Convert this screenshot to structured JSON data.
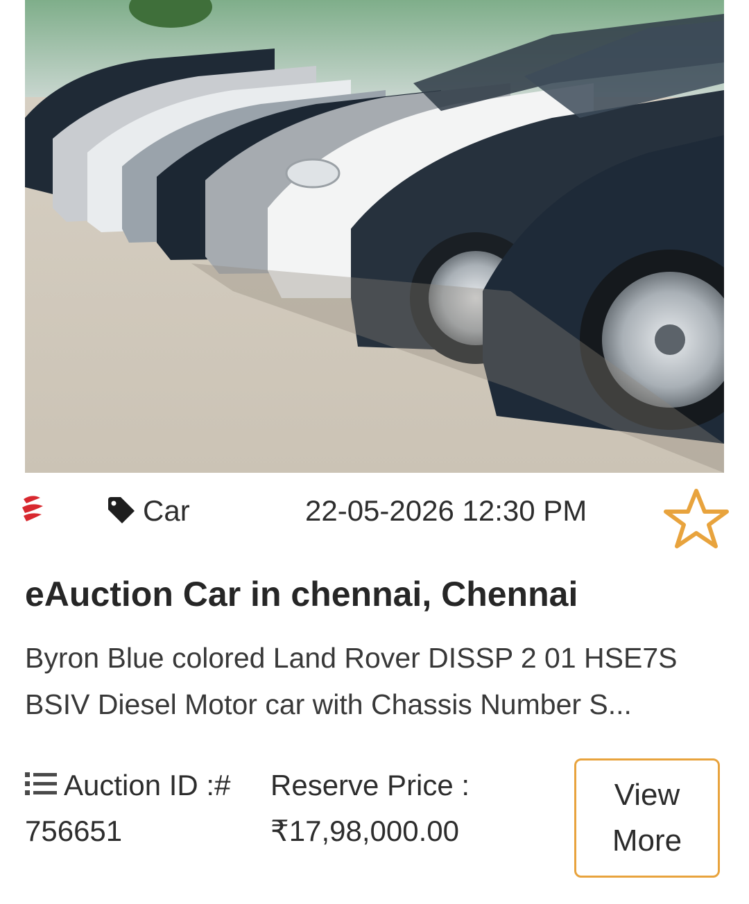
{
  "listing": {
    "image_alt": "Row of parked cars",
    "category": "Car",
    "datetime": "22-05-2026 12:30 PM",
    "title": "eAuction Car in chennai, Chennai",
    "description": "Byron Blue colored Land Rover DISSP 2 01 HSE7S BSIV Diesel Motor car with Chassis Number S...",
    "auction_id_label": "Auction ID :#",
    "auction_id": "756651",
    "reserve_price_label": "Reserve Price :",
    "reserve_price": "₹17,98,000.00",
    "view_more_label": "View More",
    "favorite": false
  },
  "icons": {
    "brand": "brand-logo-icon",
    "tag": "tag-icon",
    "favorite": "star-outline-icon",
    "list": "list-icon"
  },
  "colors": {
    "accent": "#e8a33d",
    "brand_red": "#d8282f",
    "text": "#2b2b2b"
  }
}
